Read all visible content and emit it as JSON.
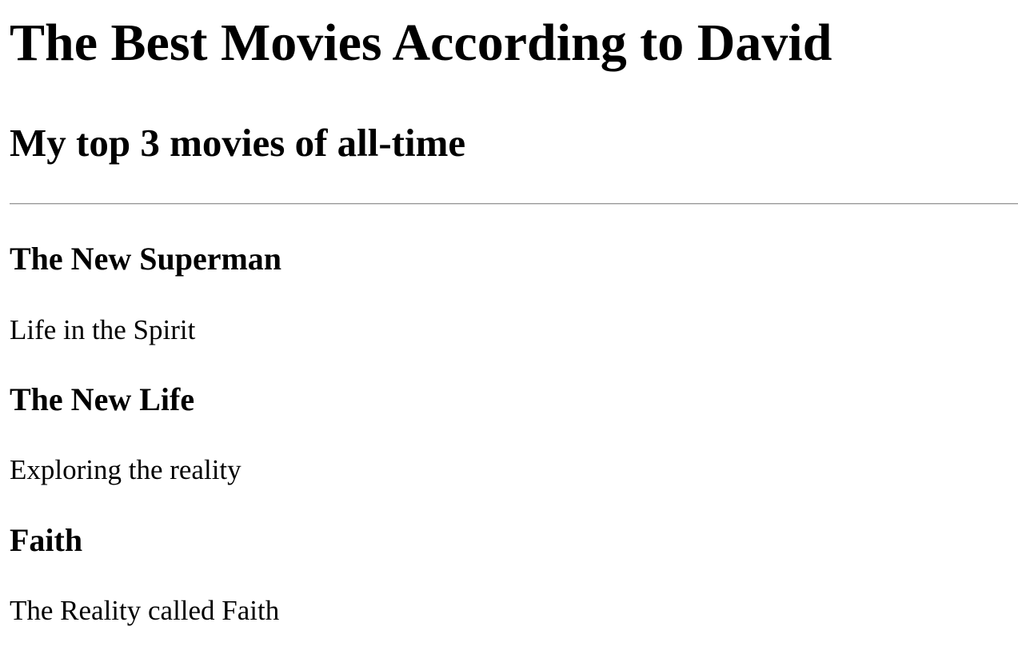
{
  "header": {
    "title": "The Best Movies According to David",
    "subtitle": "My top 3 movies of all-time"
  },
  "movies": [
    {
      "title": "The New Superman",
      "description": "Life in the Spirit"
    },
    {
      "title": "The New Life",
      "description": "Exploring the reality"
    },
    {
      "title": "Faith",
      "description": "The Reality called Faith"
    }
  ]
}
